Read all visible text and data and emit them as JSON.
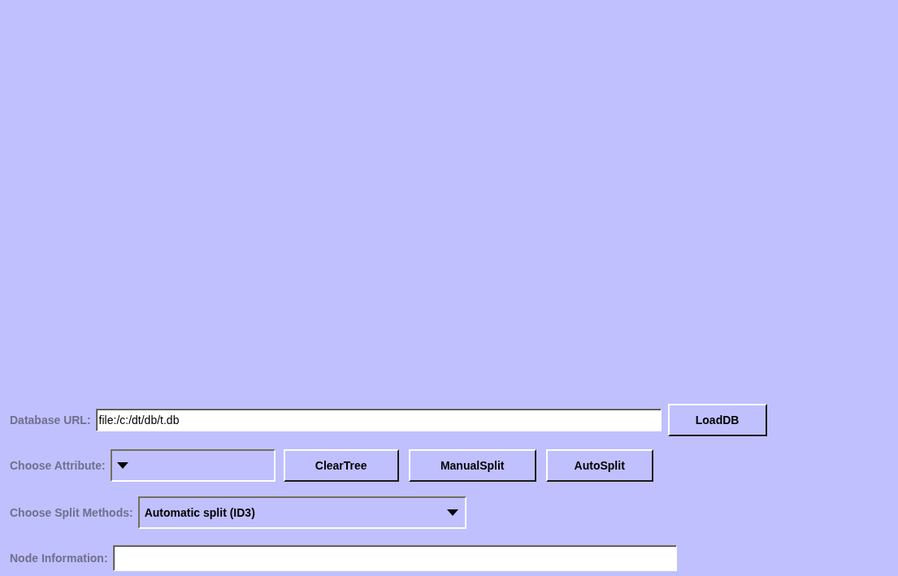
{
  "database_url": {
    "label": "Database URL:",
    "value": "file:/c:/dt/db/t.db",
    "button": "LoadDB"
  },
  "attribute": {
    "label": "Choose Attribute:",
    "buttons": [
      "ClearTree",
      "ManualSplit",
      "AutoSplit"
    ]
  },
  "split_method": {
    "label": "Choose Split Methods:",
    "value": "Automatic split (ID3)"
  },
  "node_information": {
    "label": "Node Information:"
  }
}
